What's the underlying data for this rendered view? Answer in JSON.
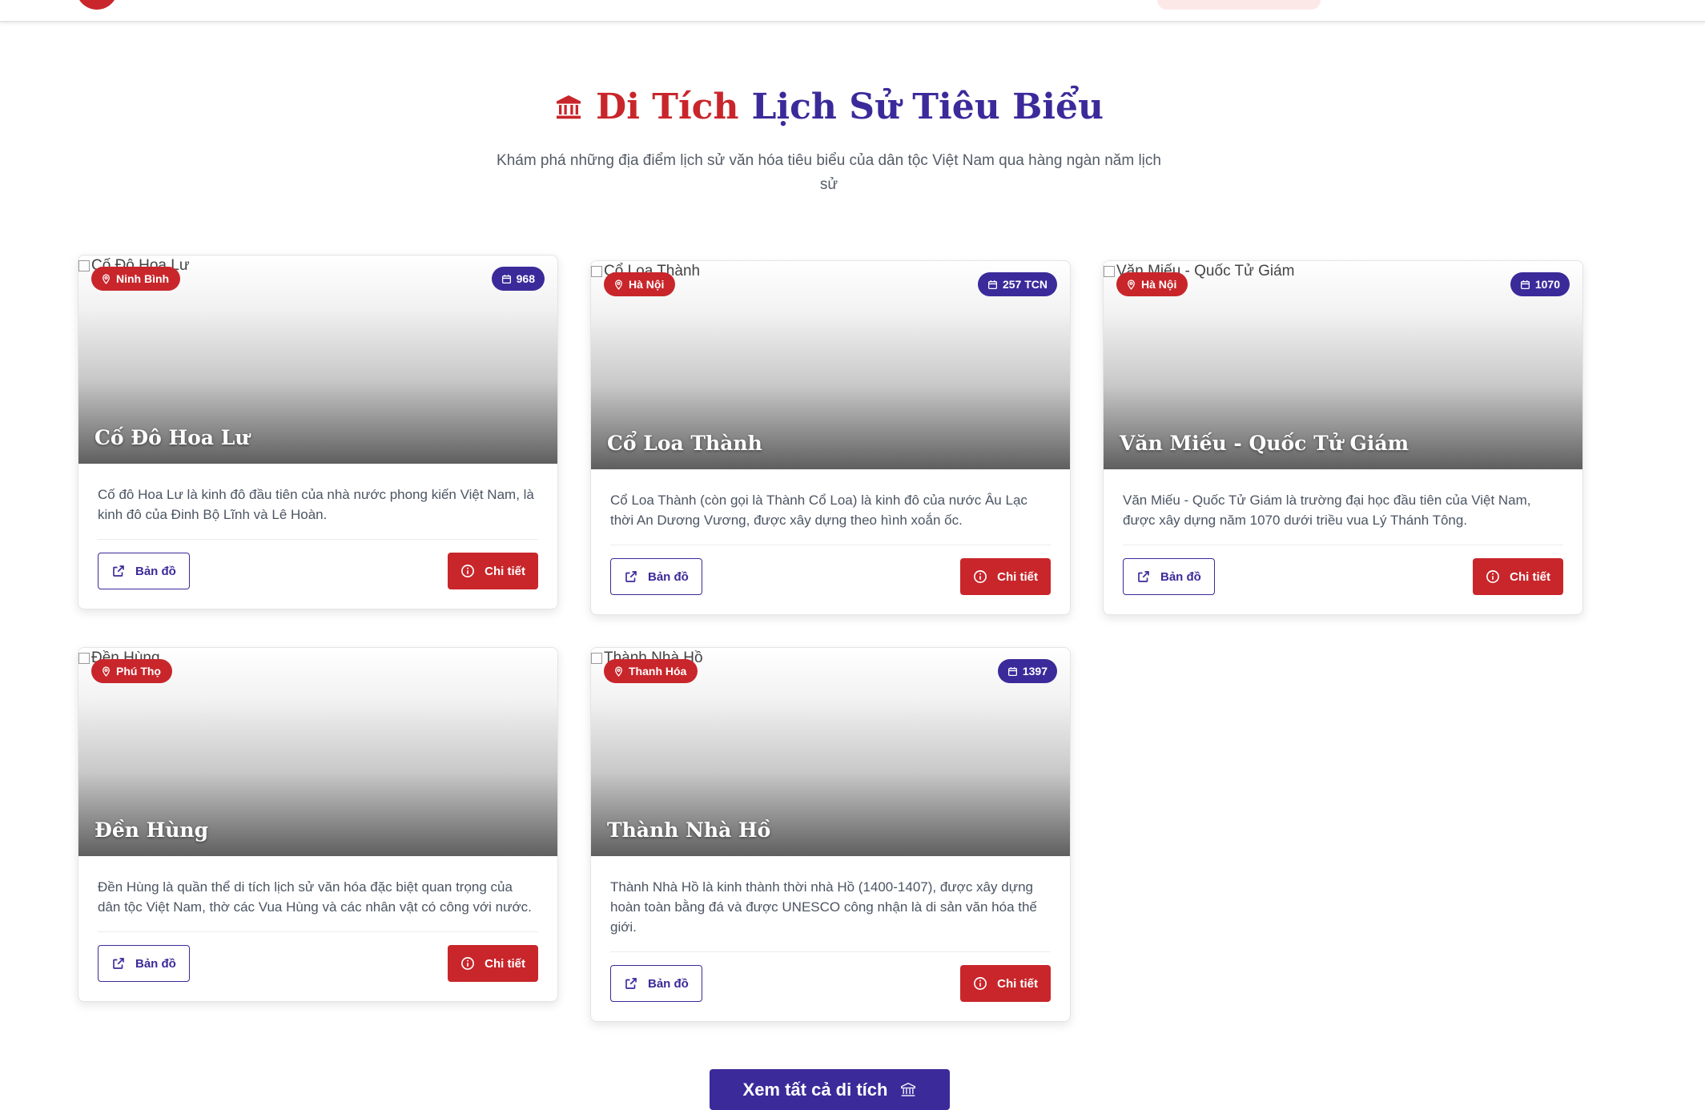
{
  "header": {
    "title_part1": "Di Tích",
    "title_part2": "Lịch Sử Tiêu Biểu",
    "icon": "museum-icon",
    "subtitle": "Khám phá những địa điểm lịch sử văn hóa tiêu biểu của dân tộc Việt Nam qua hàng ngàn năm lịch sử"
  },
  "cards": [
    {
      "alt": "Cố Đô Hoa Lư",
      "location": "Ninh Bình",
      "year": "968",
      "title": "Cố Đô Hoa Lư",
      "description": "Cố đô Hoa Lư là kinh đô đầu tiên của nhà nước phong kiến Việt Nam, là kinh đô của Đinh Bộ Lĩnh và Lê Hoàn.",
      "map_label": "Bản đồ",
      "detail_label": "Chi tiết"
    },
    {
      "alt": "Cổ Loa Thành",
      "location": "Hà Nội",
      "year": "257 TCN",
      "title": "Cổ Loa Thành",
      "description": "Cổ Loa Thành (còn gọi là Thành Cổ Loa) là kinh đô của nước Âu Lạc thời An Dương Vương, được xây dựng theo hình xoắn ốc.",
      "map_label": "Bản đồ",
      "detail_label": "Chi tiết"
    },
    {
      "alt": "Văn Miếu - Quốc Tử Giám",
      "location": "Hà Nội",
      "year": "1070",
      "title": "Văn Miếu - Quốc Tử Giám",
      "description": "Văn Miếu - Quốc Tử Giám là trường đại học đầu tiên của Việt Nam, được xây dựng năm 1070 dưới triều vua Lý Thánh Tông.",
      "map_label": "Bản đồ",
      "detail_label": "Chi tiết"
    },
    {
      "alt": "Đền Hùng",
      "location": "Phú Thọ",
      "year": "",
      "title": "Đền Hùng",
      "description": "Đền Hùng là quần thể di tích lịch sử văn hóa đặc biệt quan trọng của dân tộc Việt Nam, thờ các Vua Hùng và các nhân vật có công với nước.",
      "map_label": "Bản đồ",
      "detail_label": "Chi tiết"
    },
    {
      "alt": "Thành Nhà Hồ",
      "location": "Thanh Hóa",
      "year": "1397",
      "title": "Thành Nhà Hồ",
      "description": "Thành Nhà Hồ là kinh thành thời nhà Hồ (1400-1407), được xây dựng hoàn toàn bằng đá và được UNESCO công nhận là di sản văn hóa thế giới.",
      "map_label": "Bản đồ",
      "detail_label": "Chi tiết"
    }
  ],
  "cta": {
    "label": "Xem tất cả di tích",
    "icon": "museum-icon"
  },
  "colors": {
    "primary_red": "#c8262b",
    "primary_purple": "#3b2a9a"
  }
}
